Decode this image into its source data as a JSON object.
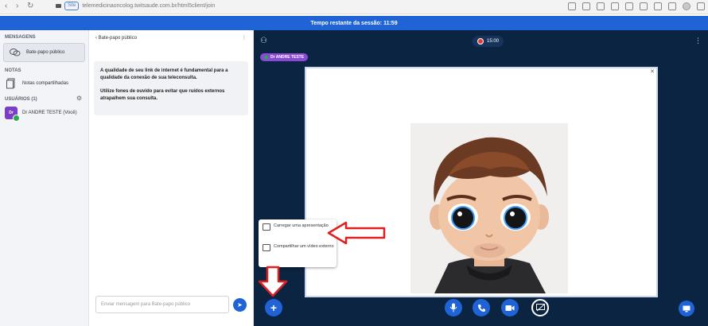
{
  "browser": {
    "url": "telemedicinaoncolog.twitsaude.com.br/html5client/join",
    "secure_label": "Site"
  },
  "session": {
    "banner": "Tempo restante da sessão: 11:59"
  },
  "sidebar": {
    "messages_title": "MENSAGENS",
    "public_chat_label": "Bate-papo público",
    "notes_title": "NOTAS",
    "shared_notes_label": "Notas compartilhadas",
    "users_title": "USUÁRIOS (1)",
    "user": {
      "initials": "Dr",
      "name": "Dr ANDRE TESTE (Você)"
    }
  },
  "chat": {
    "header_title": "Bate-papo público",
    "info_line1": "A qualidade de seu link de internet é fundamental para a qualidade da conexão de sua teleconsulta.",
    "info_line2": "Utilize fones de ouvido para evitar que ruídos externos atrapalhem sua consulta.",
    "input_placeholder": "Enviar mensagem para Bate-papo público"
  },
  "meeting": {
    "timer": "15:00",
    "presenter": "Dr ANDRE TESTE",
    "menu": {
      "upload_presentation": "Carregar uma apresentação",
      "share_video": "Compartilhar um vídeo externo"
    },
    "annotation_color": "#e02020",
    "accent": "#1f63d7",
    "background": "#0b2441"
  }
}
